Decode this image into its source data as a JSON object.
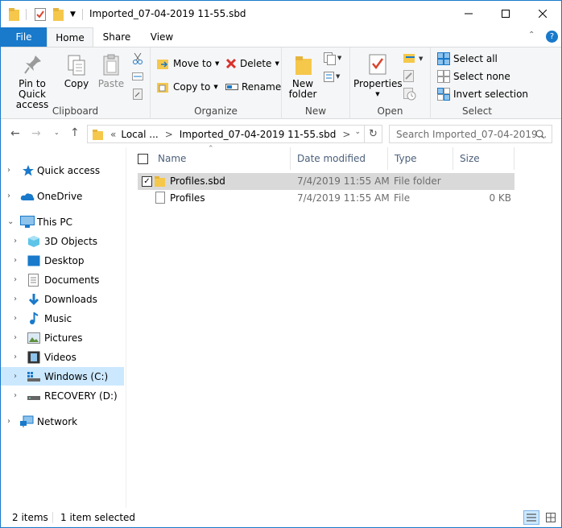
{
  "window": {
    "title": "Imported_07-04-2019 11-55.sbd",
    "controls": [
      "minimize",
      "maximize",
      "close"
    ]
  },
  "ribbon_tabs": {
    "file": "File",
    "home": "Home",
    "share": "Share",
    "view": "View"
  },
  "ribbon": {
    "clipboard": {
      "label": "Clipboard",
      "pin": "Pin to Quick access",
      "copy": "Copy",
      "paste": "Paste"
    },
    "organize": {
      "label": "Organize",
      "move_to": "Move to",
      "copy_to": "Copy to",
      "delete": "Delete",
      "rename": "Rename"
    },
    "new": {
      "label": "New",
      "new_folder": "New folder"
    },
    "open": {
      "label": "Open",
      "properties": "Properties"
    },
    "select": {
      "label": "Select",
      "select_all": "Select all",
      "select_none": "Select none",
      "invert": "Invert selection"
    }
  },
  "address": {
    "prefix": "«",
    "crumb1": "Local ...",
    "sep1": ">",
    "crumb2": "Imported_07-04-2019 11-55.sbd",
    "sep2": ">",
    "search_placeholder": "Search Imported_07-04-2019..."
  },
  "nav": {
    "quick_access": "Quick access",
    "onedrive": "OneDrive",
    "this_pc": "This PC",
    "objects": "3D Objects",
    "desktop": "Desktop",
    "documents": "Documents",
    "downloads": "Downloads",
    "music": "Music",
    "pictures": "Pictures",
    "videos": "Videos",
    "windows_c": "Windows (C:)",
    "recovery_d": "RECOVERY (D:)",
    "network": "Network"
  },
  "columns": {
    "name": "Name",
    "date": "Date modified",
    "type": "Type",
    "size": "Size"
  },
  "files": [
    {
      "name": "Profiles.sbd",
      "date": "7/4/2019 11:55 AM",
      "type": "File folder",
      "size": ""
    },
    {
      "name": "Profiles",
      "date": "7/4/2019 11:55 AM",
      "type": "File",
      "size": "0 KB"
    }
  ],
  "status": {
    "count": "2 items",
    "selected": "1 item selected"
  },
  "colors": {
    "accent": "#1979ca",
    "selection": "#cce8ff",
    "row_selected": "#d9d9d9"
  }
}
